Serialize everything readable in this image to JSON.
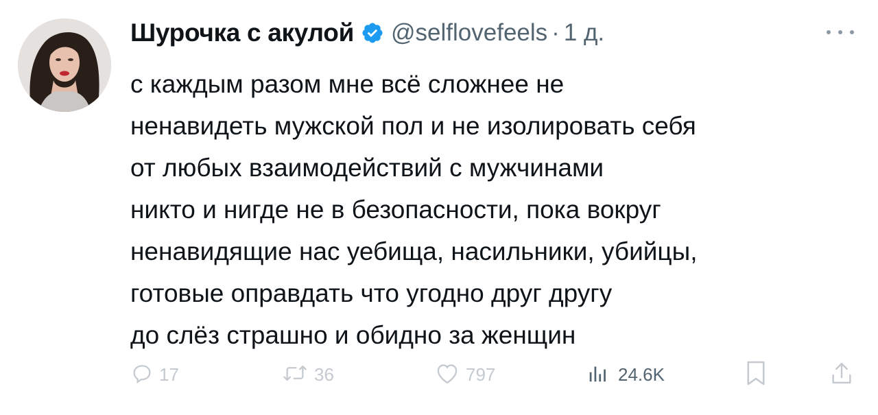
{
  "author": {
    "display_name": "Шурочка с акулой",
    "verified": true,
    "handle": "@selflovefeels",
    "separator": "·",
    "timestamp": "1 д."
  },
  "tweet": {
    "lines": [
      "с каждым разом мне всё сложнее не",
      "ненавидеть мужской пол и не изолировать себя",
      "от любых взаимодействий с мужчинами",
      "никто и нигде не в безопасности, пока вокруг",
      "ненавидящие нас уебища, насильники, убийцы,",
      "готовые оправдать что угодно друг другу",
      "до слёз страшно и обидно за женщин"
    ]
  },
  "actions": {
    "replies": "17",
    "reposts": "36",
    "likes": "797",
    "views": "24.6K"
  },
  "icons": {
    "verified": "verified-badge-icon",
    "more": "more-icon",
    "reply": "reply-icon",
    "repost": "repost-icon",
    "like": "like-icon",
    "views": "views-icon",
    "bookmark": "bookmark-icon",
    "share": "share-icon"
  },
  "colors": {
    "verified_blue": "#1d9bf0",
    "text": "#0f1419",
    "secondary": "#536471",
    "faded": "#c4cad0"
  }
}
